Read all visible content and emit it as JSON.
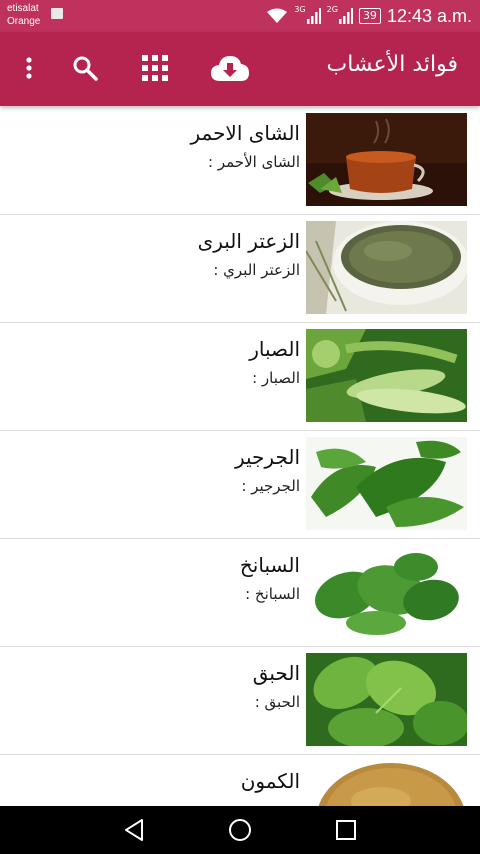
{
  "status_bar": {
    "carrier_line1": "etisalat",
    "carrier_line2": "Orange",
    "network1": "3G",
    "network2": "2G",
    "battery": "39",
    "time": "12:43 a.m."
  },
  "app_bar": {
    "title": "فوائد الأعشاب",
    "color": "#b5244f",
    "icons": [
      "overflow-menu-icon",
      "search-icon",
      "grid-icon",
      "cloud-download-icon"
    ]
  },
  "items": [
    {
      "title": "الشاى الاحمر",
      "subtitle": "الشاى الأحمر :",
      "image": "red-tea"
    },
    {
      "title": "الزعتر البرى",
      "subtitle": "الزعتر البري :",
      "image": "wild-thyme"
    },
    {
      "title": "الصبار",
      "subtitle": "الصبار :",
      "image": "aloe-vera"
    },
    {
      "title": "الجرجير",
      "subtitle": "الجرجير :",
      "image": "arugula"
    },
    {
      "title": "السبانخ",
      "subtitle": "السبانخ :",
      "image": "spinach"
    },
    {
      "title": "الحبق",
      "subtitle": "الحبق :",
      "image": "basil"
    },
    {
      "title": "الكمون",
      "subtitle": "",
      "image": "cumin"
    }
  ],
  "nav_bar": {
    "icons": [
      "back-icon",
      "home-icon",
      "recents-icon"
    ]
  }
}
